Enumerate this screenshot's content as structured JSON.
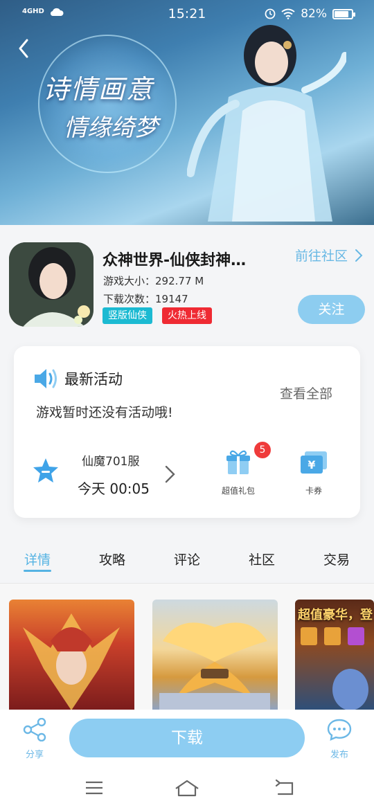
{
  "status_bar": {
    "network": "4GHD",
    "time": "15:21",
    "battery_text": "82%",
    "battery_level": 0.82
  },
  "banner": {
    "slogan_line1": "诗情画意",
    "slogan_line2": "情缘绮梦"
  },
  "app": {
    "name": "众神世界-仙侠封神…",
    "size": "游戏大小：292.77 M",
    "downloads": "下载次数：19147",
    "tags": [
      "竖版仙侠",
      "火热上线"
    ],
    "community_link": "前往社区",
    "follow_label": "关注"
  },
  "activity": {
    "title": "最新活动",
    "see_all": "查看全部",
    "empty_text": "游戏暂时还没有活动哦!",
    "server_name": "仙魔701服",
    "server_time": "今天 00:05",
    "gift_label": "超值礼包",
    "gift_badge": "5",
    "coupon_label": "卡券"
  },
  "tabs": [
    {
      "label": "详情",
      "active": true
    },
    {
      "label": "攻略",
      "active": false
    },
    {
      "label": "评论",
      "active": false
    },
    {
      "label": "社区",
      "active": false
    },
    {
      "label": "交易",
      "active": false
    }
  ],
  "screenshots": {
    "third_caption": "超值豪华，登"
  },
  "bottom_bar": {
    "share_label": "分享",
    "download_label": "下载",
    "publish_label": "发布"
  },
  "colors": {
    "accent": "#55b3e3",
    "button_light": "#8dcdf0",
    "tag_cyan": "#1cbad2",
    "tag_red": "#ef2a33",
    "badge_red": "#ef3b3b"
  }
}
